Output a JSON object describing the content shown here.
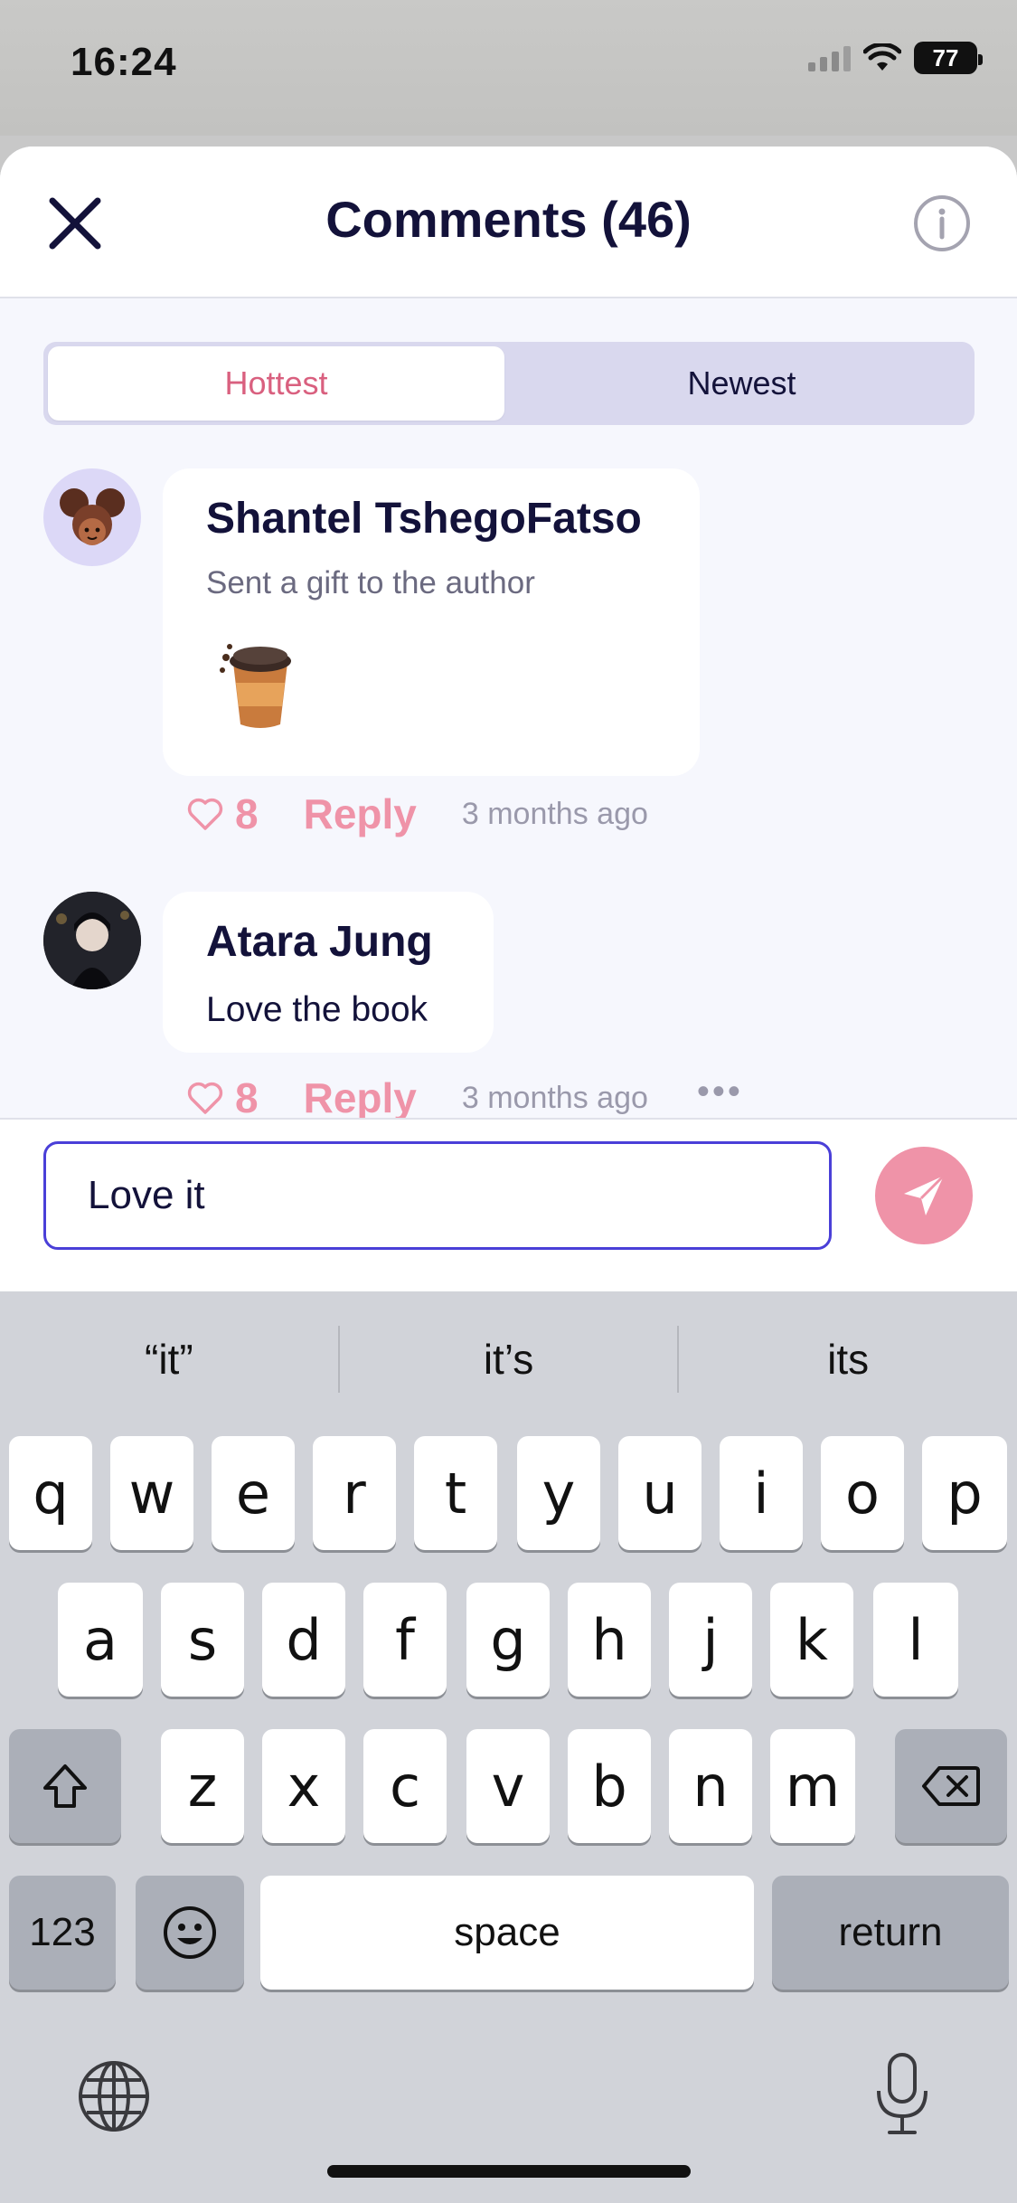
{
  "status_bar": {
    "time": "16:24",
    "battery": "77"
  },
  "header": {
    "title": "Comments (46)"
  },
  "tabs": [
    {
      "label": "Hottest",
      "active": true
    },
    {
      "label": "Newest",
      "active": false
    }
  ],
  "comments": [
    {
      "author": "Shantel TshegoFatso",
      "subtitle": "Sent a gift to the author",
      "text": "",
      "likes": "8",
      "reply_label": "Reply",
      "time_ago": "3 months ago",
      "has_gift": true
    },
    {
      "author": "Atara Jung",
      "subtitle": "",
      "text": "Love the book",
      "likes": "8",
      "reply_label": "Reply",
      "time_ago": "3 months ago",
      "more": "•••"
    }
  ],
  "input": {
    "value": "Love it"
  },
  "keyboard": {
    "suggestions": [
      "“it”",
      "it’s",
      "its"
    ],
    "row1": [
      "q",
      "w",
      "e",
      "r",
      "t",
      "y",
      "u",
      "i",
      "o",
      "p"
    ],
    "row2": [
      "a",
      "s",
      "d",
      "f",
      "g",
      "h",
      "j",
      "k",
      "l"
    ],
    "row3": [
      "z",
      "x",
      "c",
      "v",
      "b",
      "n",
      "m"
    ],
    "numbers_key": "123",
    "space_key": "space",
    "return_key": "return"
  },
  "colors": {
    "accent": "#ef93a8",
    "active_tab_text": "#d9607f",
    "input_border": "#4a3fd8",
    "title": "#13123a"
  }
}
